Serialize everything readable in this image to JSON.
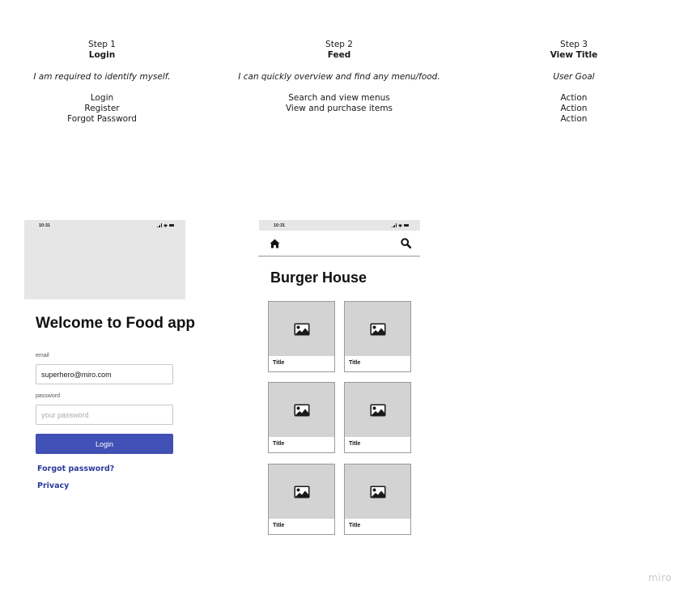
{
  "steps": [
    {
      "step": "Step 1",
      "title": "Login",
      "goal": "I am required to identify myself.",
      "actions": [
        "Login",
        "Register",
        "Forgot Password"
      ]
    },
    {
      "step": "Step 2",
      "title": "Feed",
      "goal": "I can quickly overview and find any menu/food.",
      "actions": [
        "Search and view menus",
        "View and purchase items"
      ]
    },
    {
      "step": "Step 3",
      "title": "View Title",
      "goal": "User Goal",
      "actions": [
        "Action",
        "Action",
        "Action"
      ]
    }
  ],
  "login_screen": {
    "status_time": "10:31",
    "heading": "Welcome to Food app",
    "email_label": "email",
    "email_value": "superhero@miro.com",
    "password_label": "password",
    "password_placeholder": "your password",
    "login_button": "Login",
    "forgot_link": "Forgot password?",
    "privacy_link": "Privacy",
    "accent_color": "#4050b5"
  },
  "feed_screen": {
    "status_time": "10:31",
    "nav_icons": [
      "home-icon",
      "search-icon"
    ],
    "heading": "Burger House",
    "cards": [
      {
        "title": "Title",
        "icon": "image-icon"
      },
      {
        "title": "Title",
        "icon": "image-icon"
      },
      {
        "title": "Title",
        "icon": "image-icon"
      },
      {
        "title": "Title",
        "icon": "image-icon"
      },
      {
        "title": "Title",
        "icon": "image-icon"
      },
      {
        "title": "Title",
        "icon": "image-icon"
      }
    ]
  },
  "watermark": "miro"
}
